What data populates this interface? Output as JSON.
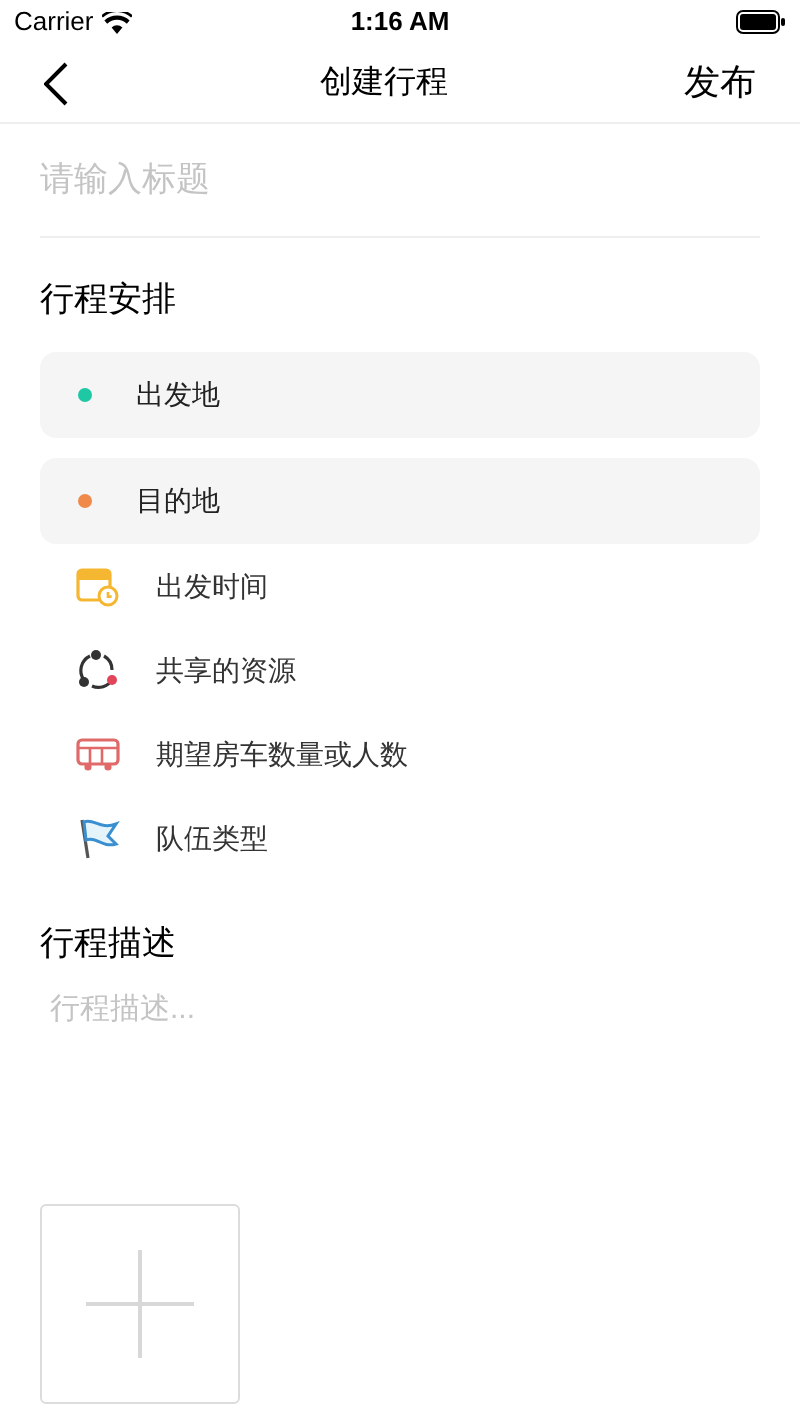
{
  "status_bar": {
    "carrier": "Carrier",
    "time": "1:16 AM"
  },
  "nav": {
    "title": "创建行程",
    "action": "发布"
  },
  "title_field": {
    "placeholder": "请输入标题"
  },
  "schedule": {
    "heading": "行程安排",
    "locations": [
      {
        "label": "出发地",
        "color": "#1ec8a5"
      },
      {
        "label": "目的地",
        "color": "#f08a4b"
      }
    ],
    "options": [
      {
        "kind": "calendar",
        "label": "出发时间"
      },
      {
        "kind": "share",
        "label": "共享的资源"
      },
      {
        "kind": "bus",
        "label": "期望房车数量或人数"
      },
      {
        "kind": "flag",
        "label": "队伍类型"
      }
    ]
  },
  "description": {
    "heading": "行程描述",
    "placeholder": "行程描述..."
  },
  "upload": {
    "kind": "add-tile"
  }
}
